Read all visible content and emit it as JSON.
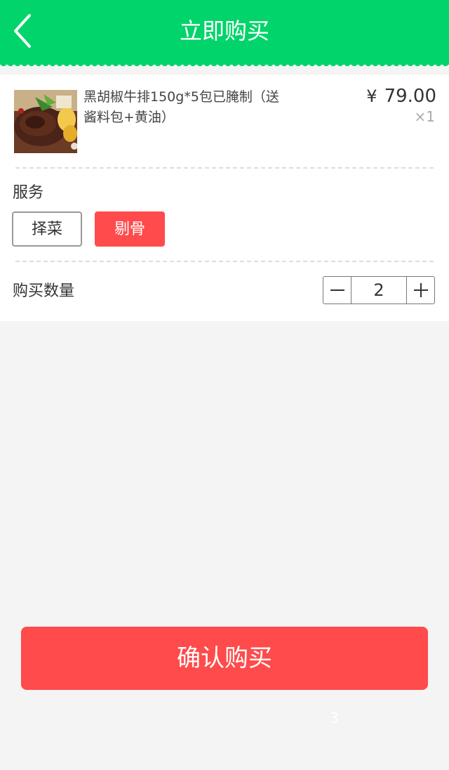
{
  "header": {
    "title": "立即购买",
    "bg_color": "#00d46a",
    "back_icon": "chevron-left-icon"
  },
  "product": {
    "name": "黑胡椒牛排150g*5包已腌制（送酱料包+黄油）",
    "price_symbol": "¥",
    "price": "79.00",
    "quantity_tag": "×1",
    "image": "steak-photo"
  },
  "service": {
    "label": "服务",
    "options": [
      {
        "label": "择菜",
        "selected": false
      },
      {
        "label": "剔骨",
        "selected": true
      }
    ],
    "selected_color": "#ff4b4b"
  },
  "quantity": {
    "label": "购买数量",
    "value": "2",
    "minus_icon": "minus-icon",
    "plus_icon": "plus-icon"
  },
  "confirm": {
    "label": "确认购买",
    "color": "#ff4b4b"
  },
  "footer": {
    "page_number": "3"
  }
}
